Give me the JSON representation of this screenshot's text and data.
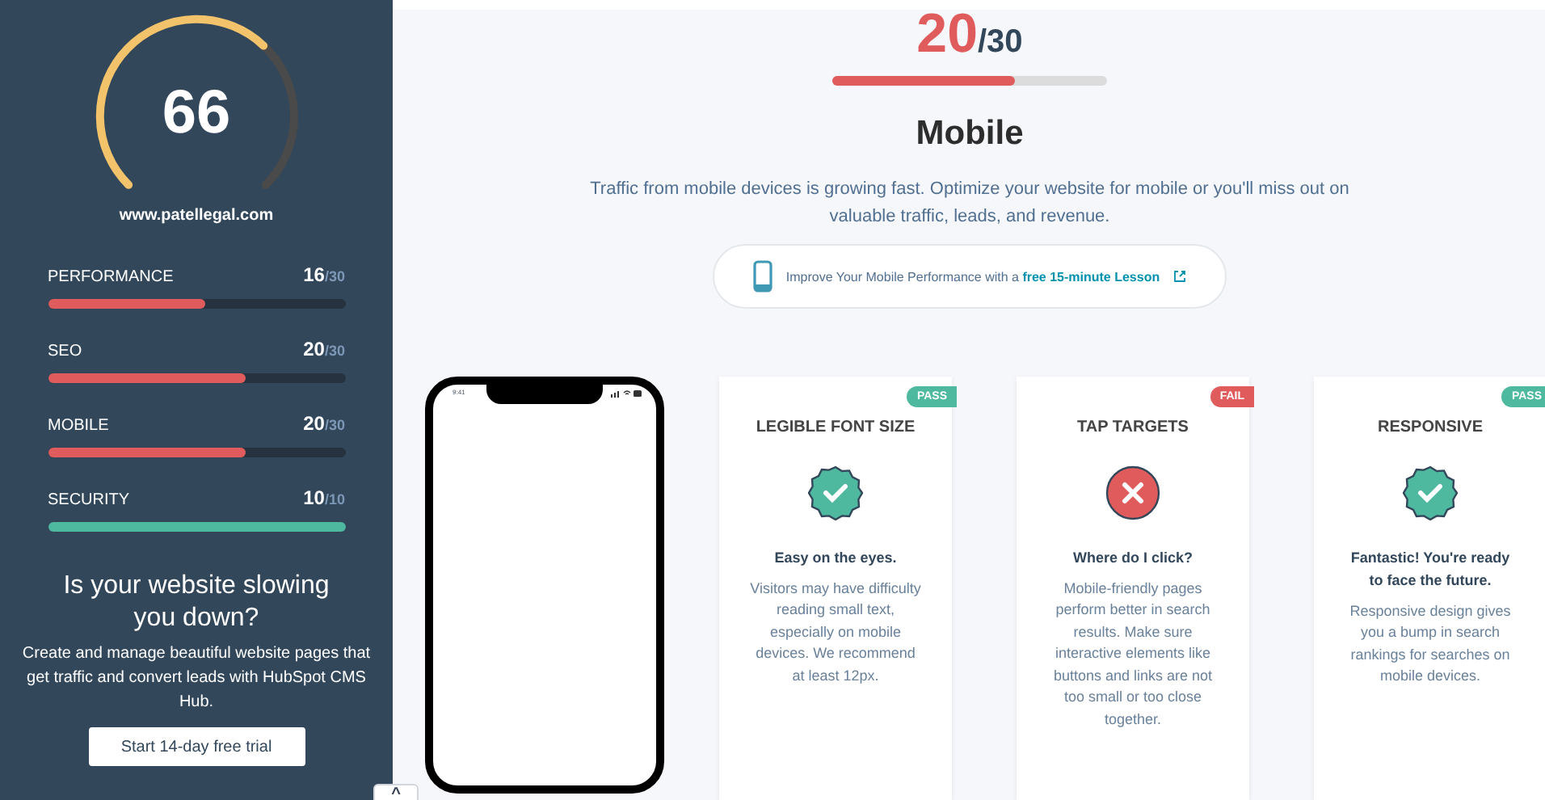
{
  "sidebar": {
    "score": "66",
    "site": "www.patellegal.com",
    "categories": [
      {
        "name": "PERFORMANCE",
        "score": "16",
        "max": "/30",
        "level": 0.53,
        "color": "#e05c5c"
      },
      {
        "name": "SEO",
        "score": "20",
        "max": "/30",
        "level": 0.667,
        "color": "#e05c5c"
      },
      {
        "name": "MOBILE",
        "score": "20",
        "max": "/30",
        "level": 0.667,
        "color": "#e05c5c"
      },
      {
        "name": "SECURITY",
        "score": "10",
        "max": "/10",
        "level": 1,
        "color": "#4fb9a0"
      }
    ],
    "promo": {
      "title": "Is your website slowing you down?",
      "text": "Create and manage beautiful website pages that get traffic and convert leads with HubSpot CMS Hub.",
      "button": "Start 14-day free trial"
    },
    "scroll_button": "^"
  },
  "main": {
    "score": "20",
    "max": "/30",
    "level": 0.667,
    "title": "Mobile",
    "description": "Traffic from mobile devices is growing fast. Optimize your website for mobile or you'll miss out on valuable traffic, leads, and revenue.",
    "lesson": {
      "text": "Improve Your Mobile Performance with a ",
      "link": "free 15-minute Lesson"
    },
    "phone": {
      "time": "9:41"
    },
    "checks": [
      {
        "kind": "pass",
        "badge": "PASS",
        "title": "LEGIBLE FONT SIZE",
        "headline": "Easy on the eyes.",
        "text": "Visitors may have difficulty reading small text, especially on mobile devices. We recommend at least 12px."
      },
      {
        "kind": "fail",
        "badge": "FAIL",
        "title": "TAP TARGETS",
        "headline": "Where do I click?",
        "text": "Mobile-friendly pages perform better in search results. Make sure interactive elements like buttons and links are not too small or too close together."
      },
      {
        "kind": "pass",
        "badge": "PASS",
        "title": "RESPONSIVE",
        "headline": "Fantastic! You're ready to face the future.",
        "text": "Responsive design gives you a bump in search rankings for searches on mobile devices."
      }
    ]
  }
}
